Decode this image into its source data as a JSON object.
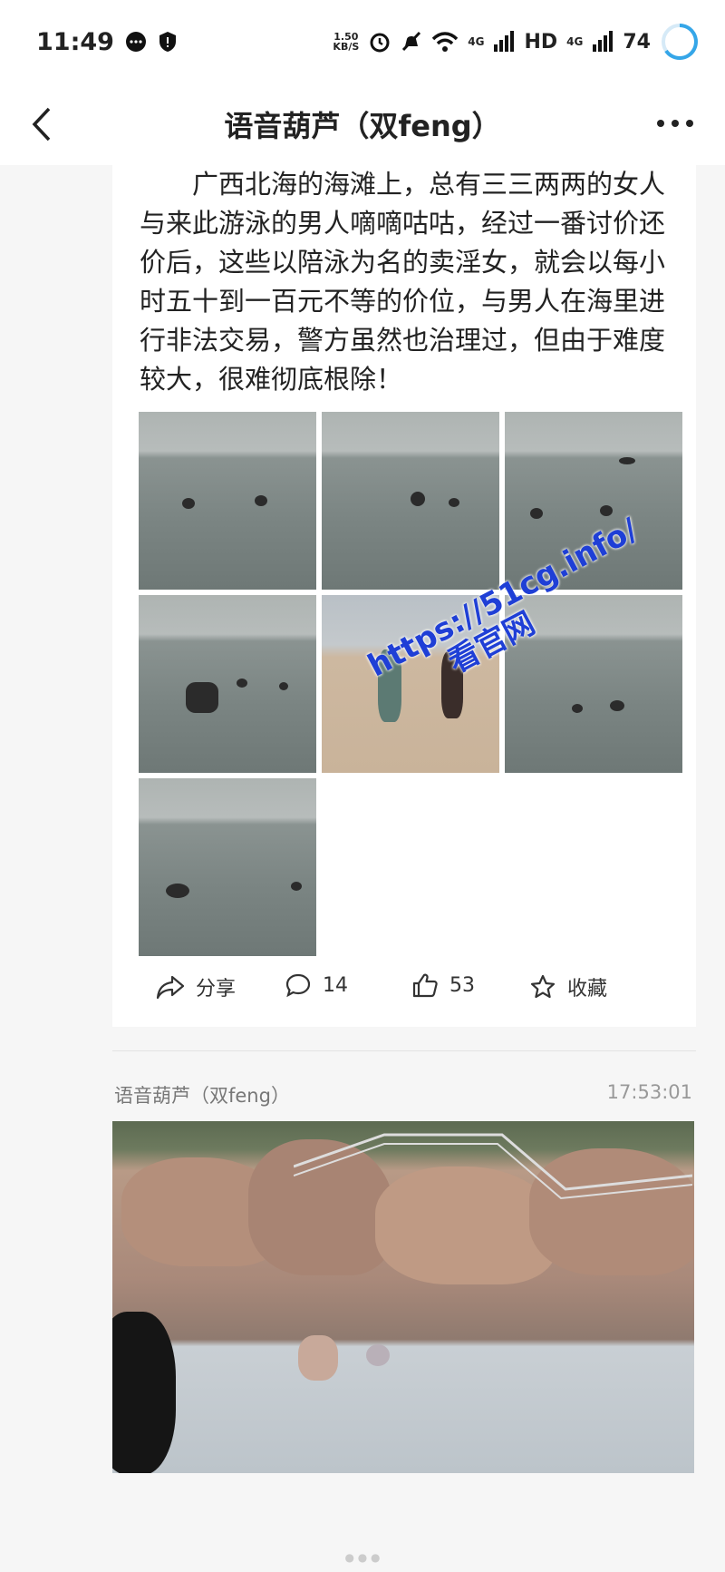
{
  "status": {
    "time": "11:49",
    "speed_value": "1.50",
    "speed_unit": "KB/S",
    "network_a": "4G",
    "hd": "HD",
    "network_b": "4G",
    "battery": "74"
  },
  "nav": {
    "title": "语音葫芦（双feng）"
  },
  "post": {
    "text": "广西北海的海滩上，总有三三两两的女人与来此游泳的男人嘀嘀咕咕，经过一番讨价还价后，这些以陪泳为名的卖淫女，就会以每小时五十到一百元不等的价位，与男人在海里进行非法交易，警方虽然也治理过，但由于难度较大，很难彻底根除！",
    "share_label": "分享",
    "comment_count": "14",
    "like_count": "53",
    "favorite_label": "收藏"
  },
  "next_post": {
    "author": "语音葫芦（双feng）",
    "time": "17:53:01"
  },
  "watermark": {
    "line1": "https://51cg.info/",
    "line2": "看官网"
  }
}
